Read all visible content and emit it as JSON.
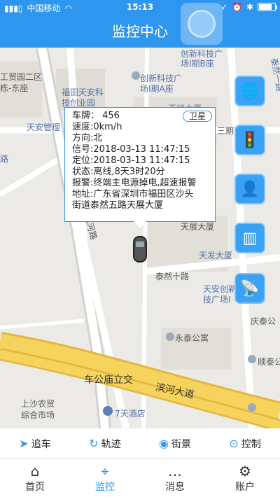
{
  "status": {
    "carrier": "中国移动",
    "time": "15:13"
  },
  "header": {
    "title": "监控中心"
  },
  "map": {
    "labels": [
      "工贸园二区",
      "栋-东座",
      "福田天安科",
      "技创业园",
      "天安管理",
      "创新科技广",
      "场I期B座",
      "创新科技广",
      "场I期A座",
      "天祥大厦",
      "三期7",
      "天展大厦",
      "天发大厦",
      "泰然十路",
      "天安创新",
      "技广场I",
      "庆泰公",
      "永泰公寓",
      "顺泰公",
      "车公庙立交",
      "滨河大道",
      "上沙农贸",
      "综合市场",
      "7天酒店",
      "泰然一路",
      "路",
      "滨河路"
    ]
  },
  "popup": {
    "satellite": "卫星",
    "lines": [
      "车牌： 456",
      "速度:0km/h",
      "方向:北",
      "信号:2018-03-13 11:47:15",
      "定位:2018-03-13 11:47:15",
      "状态:离线,8天3时20分",
      "报警:终端主电源掉电,超速报警",
      "地址:广东省深圳市福田区沙头",
      "街道泰然五路天展大厦"
    ]
  },
  "side_buttons": [
    "globe-icon",
    "traffic-light-icon",
    "person-icon",
    "fence-icon",
    "antenna-icon"
  ],
  "actions": [
    {
      "label": "追车",
      "icon": "➤"
    },
    {
      "label": "轨迹",
      "icon": "↻"
    },
    {
      "label": "街景",
      "icon": "◉"
    },
    {
      "label": "控制",
      "icon": "⊙"
    }
  ],
  "tabs": [
    {
      "label": "首页",
      "icon": "⌂"
    },
    {
      "label": "监控",
      "icon": "⌖"
    },
    {
      "label": "消息",
      "icon": "…"
    },
    {
      "label": "账户",
      "icon": "⚙"
    }
  ],
  "colors": {
    "primary": "#2f96f0",
    "road_yellow": "#f2c94c",
    "map_bg": "#eceae6"
  }
}
